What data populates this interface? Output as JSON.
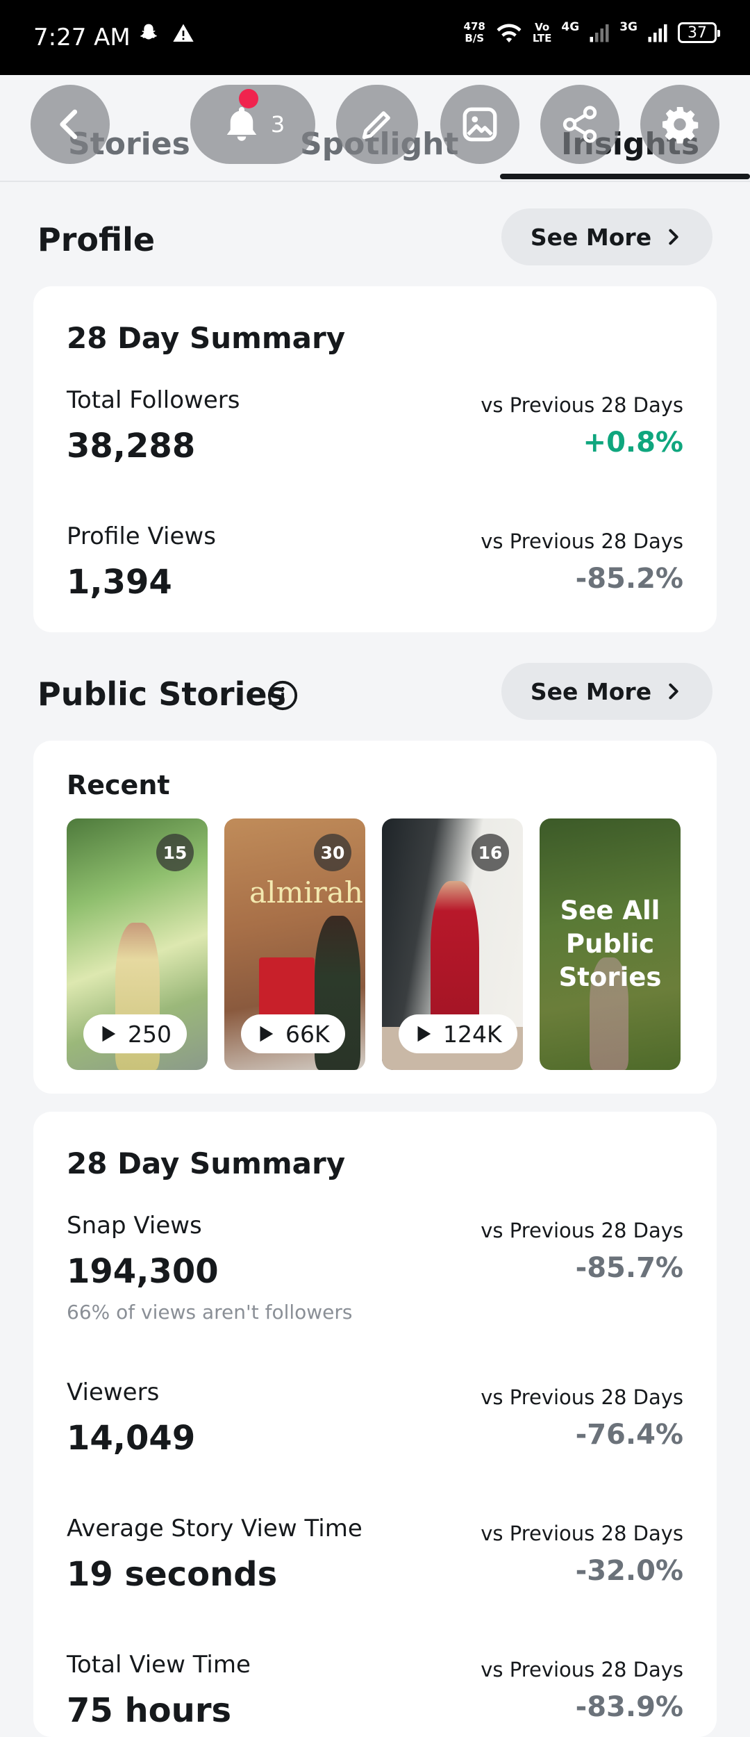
{
  "status_bar": {
    "time": "7:27 AM",
    "net_speed_value": "478",
    "net_speed_unit": "B/S",
    "volte_top": "Vo",
    "volte_bottom": "LTE",
    "signal1_label": "4G",
    "signal2_label": "3G",
    "battery": "37"
  },
  "header": {
    "tabs": [
      {
        "label": "Stories"
      },
      {
        "label": "Spotlight"
      },
      {
        "label": "Insights"
      }
    ],
    "active_tab": "Insights",
    "notification_count": "3",
    "icons": [
      "back-icon",
      "bell-icon",
      "edit-icon",
      "image-icon",
      "share-icon",
      "gear-icon"
    ]
  },
  "profile": {
    "title": "Profile",
    "see_more": "See More",
    "card_title": "28 Day Summary",
    "stats": [
      {
        "label": "Total Followers",
        "value": "38,288",
        "compare_label": "vs Previous 28 Days",
        "change": "+0.8%"
      },
      {
        "label": "Profile Views",
        "value": "1,394",
        "compare_label": "vs Previous 28 Days",
        "change": "-85.2%"
      }
    ]
  },
  "public_stories": {
    "title": "Public Stories",
    "see_more": "See More",
    "recent_title": "Recent",
    "thumbnails": [
      {
        "count": "15",
        "views": "250"
      },
      {
        "count": "30",
        "views": "66K",
        "sign_text": "almirah"
      },
      {
        "count": "16",
        "views": "124K"
      }
    ],
    "see_all_label": "See All Public Stories"
  },
  "stories_summary": {
    "card_title": "28 Day Summary",
    "stats": [
      {
        "label": "Snap Views",
        "value": "194,300",
        "note": "66% of views aren't followers",
        "compare_label": "vs Previous 28 Days",
        "change": "-85.7%"
      },
      {
        "label": "Viewers",
        "value": "14,049",
        "compare_label": "vs Previous 28 Days",
        "change": "-76.4%"
      },
      {
        "label": "Average Story View Time",
        "value": "19 seconds",
        "compare_label": "vs Previous 28 Days",
        "change": "-32.0%"
      },
      {
        "label": "Total View Time",
        "value": "75 hours",
        "compare_label": "vs Previous 28 Days",
        "change": "-83.9%"
      }
    ]
  },
  "colors": {
    "positive": "#0fa67e",
    "negative": "#6b727a",
    "accent_dot": "#f0244e"
  }
}
